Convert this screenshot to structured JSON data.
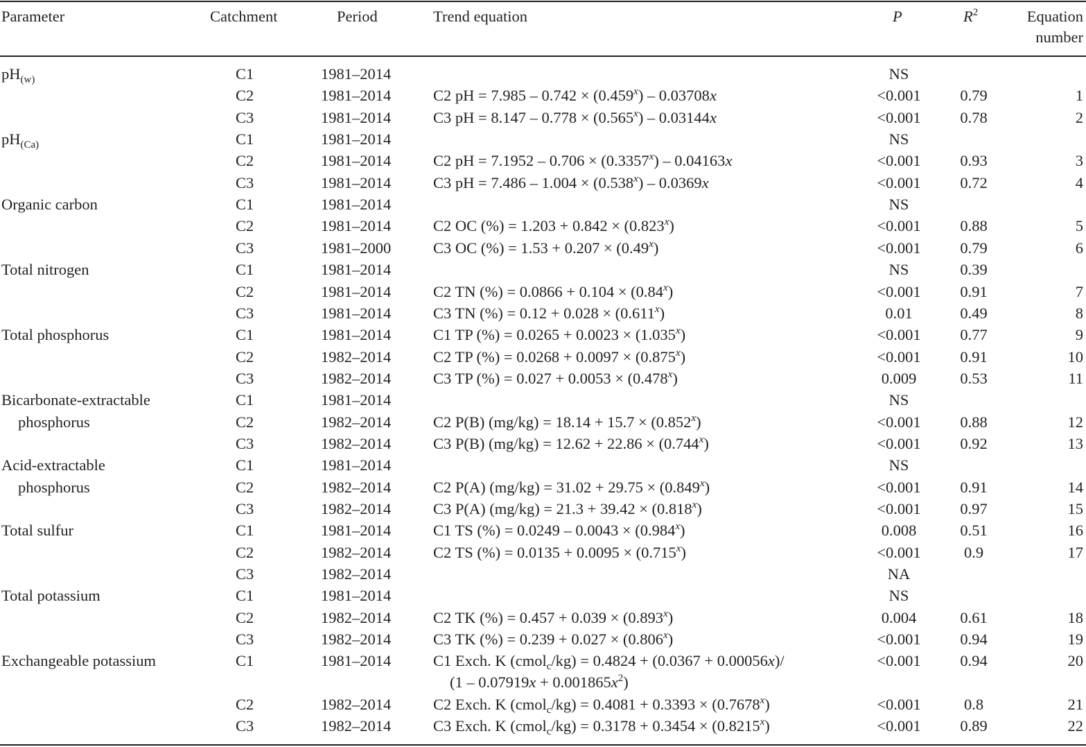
{
  "headers": {
    "parameter": "Parameter",
    "catchment": "Catchment",
    "period": "Period",
    "trend_equation": "Trend equation",
    "p": "P",
    "r2_base": "R",
    "r2_exp": "2",
    "equation_number_line1": "Equation",
    "equation_number_line2": "number"
  },
  "rows": [
    {
      "param": "pH",
      "param_sub": "(w)",
      "param2": "",
      "catch": "C1",
      "period": "1981–2014",
      "eq": "",
      "p": "NS",
      "r2": "",
      "num": ""
    },
    {
      "param": "",
      "param2": "",
      "catch": "C2",
      "period": "1981–2014",
      "eq_a": "C2 pH = 7.985 – 0.742 × (0.459",
      "eq_sup": "x",
      "eq_b": ") – 0.03708",
      "eq_var": "x",
      "p": "<0.001",
      "r2": "0.79",
      "num": "1"
    },
    {
      "param": "",
      "param2": "",
      "catch": "C3",
      "period": "1981–2014",
      "eq_a": "C3 pH = 8.147 – 0.778 × (0.565",
      "eq_sup": "x",
      "eq_b": ") – 0.03144",
      "eq_var": "x",
      "p": "<0.001",
      "r2": "0.78",
      "num": "2"
    },
    {
      "param": "pH",
      "param_sub": "(Ca)",
      "param2": "",
      "catch": "C1",
      "period": "1981–2014",
      "eq": "",
      "p": "NS",
      "r2": "",
      "num": ""
    },
    {
      "param": "",
      "param2": "",
      "catch": "C2",
      "period": "1981–2014",
      "eq_a": "C2 pH = 7.1952 – 0.706 × (0.3357",
      "eq_sup": "x",
      "eq_b": ") – 0.04163",
      "eq_var": "x",
      "p": "<0.001",
      "r2": "0.93",
      "num": "3"
    },
    {
      "param": "",
      "param2": "",
      "catch": "C3",
      "period": "1981–2014",
      "eq_a": "C3 pH = 7.486 – 1.004 × (0.538",
      "eq_sup": "x",
      "eq_b": ") – 0.0369",
      "eq_var": "x",
      "p": "<0.001",
      "r2": "0.72",
      "num": "4"
    },
    {
      "param": "Organic carbon",
      "param2": "",
      "catch": "C1",
      "period": "1981–2014",
      "eq": "",
      "p": "NS",
      "r2": "",
      "num": ""
    },
    {
      "param": "",
      "param2": "",
      "catch": "C2",
      "period": "1981–2014",
      "eq_a": "C2 OC (%) = 1.203 + 0.842 × (0.823",
      "eq_sup": "x",
      "eq_b": ")",
      "p": "<0.001",
      "r2": "0.88",
      "num": "5"
    },
    {
      "param": "",
      "param2": "",
      "catch": "C3",
      "period": "1981–2000",
      "eq_a": "C3 OC (%) = 1.53 + 0.207 × (0.49",
      "eq_sup": "x",
      "eq_b": ")",
      "p": "<0.001",
      "r2": "0.79",
      "num": "6"
    },
    {
      "param": "Total nitrogen",
      "param2": "",
      "catch": "C1",
      "period": "1981–2014",
      "eq": "",
      "p": "NS",
      "r2": "0.39",
      "num": ""
    },
    {
      "param": "",
      "param2": "",
      "catch": "C2",
      "period": "1981–2014",
      "eq_a": "C2 TN (%) = 0.0866 + 0.104 × (0.84",
      "eq_sup": "x",
      "eq_b": ")",
      "p": "<0.001",
      "r2": "0.91",
      "num": "7"
    },
    {
      "param": "",
      "param2": "",
      "catch": "C3",
      "period": "1981–2014",
      "eq_a": "C3 TN (%) = 0.12 + 0.028 × (0.611",
      "eq_sup": "x",
      "eq_b": ")",
      "p": "0.01",
      "r2": "0.49",
      "num": "8"
    },
    {
      "param": "Total phosphorus",
      "param2": "",
      "catch": "C1",
      "period": "1981–2014",
      "eq_a": "C1 TP (%) = 0.0265 + 0.0023 × (1.035",
      "eq_sup": "x",
      "eq_b": ")",
      "p": "<0.001",
      "r2": "0.77",
      "num": "9"
    },
    {
      "param": "",
      "param2": "",
      "catch": "C2",
      "period": "1982–2014",
      "eq_a": "C2 TP (%) = 0.0268 + 0.0097 × (0.875",
      "eq_sup": "x",
      "eq_b": ")",
      "p": "<0.001",
      "r2": "0.91",
      "num": "10"
    },
    {
      "param": "",
      "param2": "",
      "catch": "C3",
      "period": "1982–2014",
      "eq_a": "C3 TP (%) = 0.027 + 0.0053 × (0.478",
      "eq_sup": "x",
      "eq_b": ")",
      "p": "0.009",
      "r2": "0.53",
      "num": "11"
    },
    {
      "param": "Bicarbonate-extractable",
      "param2": "",
      "catch": "C1",
      "period": "1981–2014",
      "eq": "",
      "p": "NS",
      "r2": "",
      "num": ""
    },
    {
      "param": "",
      "param_cont": "phosphorus",
      "catch": "C2",
      "period": "1982–2014",
      "eq_a": "C2 P(B) (mg/kg) = 18.14 + 15.7 × (0.852",
      "eq_sup": "x",
      "eq_b": ")",
      "p": "<0.001",
      "r2": "0.88",
      "num": "12"
    },
    {
      "param": "",
      "param2": "",
      "catch": "C3",
      "period": "1982–2014",
      "eq_a": "C3 P(B) (mg/kg) = 12.62 + 22.86 × (0.744",
      "eq_sup": "x",
      "eq_b": ")",
      "p": "<0.001",
      "r2": "0.92",
      "num": "13"
    },
    {
      "param": "Acid-extractable",
      "param2": "",
      "catch": "C1",
      "period": "1981–2014",
      "eq": "",
      "p": "NS",
      "r2": "",
      "num": ""
    },
    {
      "param": "",
      "param_cont": "phosphorus",
      "catch": "C2",
      "period": "1982–2014",
      "eq_a": "C2 P(A) (mg/kg) = 31.02 + 29.75 × (0.849",
      "eq_sup": "x",
      "eq_b": ")",
      "p": "<0.001",
      "r2": "0.91",
      "num": "14"
    },
    {
      "param": "",
      "param2": "",
      "catch": "C3",
      "period": "1982–2014",
      "eq_a": "C3 P(A) (mg/kg) = 21.3 + 39.42 × (0.818",
      "eq_sup": "x",
      "eq_b": ")",
      "p": "<0.001",
      "r2": "0.97",
      "num": "15"
    },
    {
      "param": "Total sulfur",
      "param2": "",
      "catch": "C1",
      "period": "1981–2014",
      "eq_a": "C1 TS (%) = 0.0249 – 0.0043 × (0.984",
      "eq_sup": "x",
      "eq_b": ")",
      "p": "0.008",
      "r2": "0.51",
      "num": "16"
    },
    {
      "param": "",
      "param2": "",
      "catch": "C2",
      "period": "1982–2014",
      "eq_a": "C2 TS (%) = 0.0135 + 0.0095 × (0.715",
      "eq_sup": "x",
      "eq_b": ")",
      "p": "<0.001",
      "r2": "0.9",
      "num": "17"
    },
    {
      "param": "",
      "param2": "",
      "catch": "C3",
      "period": "1982–2014",
      "eq": "",
      "p": "NA",
      "r2": "",
      "num": ""
    },
    {
      "param": "Total potassium",
      "param2": "",
      "catch": "C1",
      "period": "1981–2014",
      "eq": "",
      "p": "NS",
      "r2": "",
      "num": ""
    },
    {
      "param": "",
      "param2": "",
      "catch": "C2",
      "period": "1982–2014",
      "eq_a": "C2 TK (%) = 0.457 + 0.039 × (0.893",
      "eq_sup": "x",
      "eq_b": ")",
      "p": "0.004",
      "r2": "0.61",
      "num": "18"
    },
    {
      "param": "",
      "param2": "",
      "catch": "C3",
      "period": "1982–2014",
      "eq_a": "C3 TK (%) = 0.239 + 0.027 × (0.806",
      "eq_sup": "x",
      "eq_b": ")",
      "p": "<0.001",
      "r2": "0.94",
      "num": "19"
    },
    {
      "param": "Exchangeable potassium",
      "param2": "",
      "catch": "C1",
      "period": "1981–2014",
      "eq_special": "k20",
      "p": "<0.001",
      "r2": "0.94",
      "num": "20"
    },
    {
      "param": "",
      "param2": "",
      "catch": "C2",
      "period": "1982–2014",
      "eq_a": "C2 Exch. K (cmol",
      "eq_csub": "c",
      "eq_mid": "/kg) = 0.4081 + 0.3393 × (0.7678",
      "eq_sup": "x",
      "eq_b": ")",
      "p": "<0.001",
      "r2": "0.8",
      "num": "21"
    },
    {
      "param": "",
      "param2": "",
      "catch": "C3",
      "period": "1982–2014",
      "eq_a": "C3 Exch. K (cmol",
      "eq_csub": "c",
      "eq_mid": "/kg) = 0.3178 + 0.3454 × (0.8215",
      "eq_sup": "x",
      "eq_b": ")",
      "p": "<0.001",
      "r2": "0.89",
      "num": "22"
    }
  ],
  "k20": {
    "l1_a": "C1 Exch. K (cmol",
    "l1_sub": "c",
    "l1_b": "/kg) = 0.4824 + (0.0367 + 0.00056",
    "l1_var": "x",
    "l1_c": ")/",
    "l2_a": "(1 – 0.07919",
    "l2_var1": "x",
    "l2_b": " + 0.001865",
    "l2_var2": "x",
    "l2_sup": "2",
    "l2_c": ")"
  }
}
